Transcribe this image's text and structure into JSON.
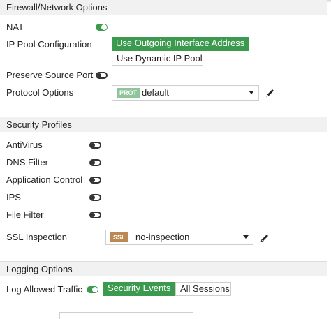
{
  "firewall": {
    "header": "Firewall/Network Options",
    "nat": {
      "label": "NAT",
      "enabled": true
    },
    "ip_pool": {
      "label": "IP Pool Configuration",
      "options": [
        "Use Outgoing Interface Address",
        "Use Dynamic IP Pool"
      ],
      "selected": "Use Outgoing Interface Address"
    },
    "preserve_source_port": {
      "label": "Preserve Source Port",
      "enabled": false
    },
    "protocol_options": {
      "label": "Protocol Options",
      "badge": "PROT",
      "value": "default",
      "badge_color": "#8fc59a"
    }
  },
  "security": {
    "header": "Security Profiles",
    "items": [
      {
        "label": "AntiVirus",
        "enabled": false
      },
      {
        "label": "DNS Filter",
        "enabled": false
      },
      {
        "label": "Application Control",
        "enabled": false
      },
      {
        "label": "IPS",
        "enabled": false
      },
      {
        "label": "File Filter",
        "enabled": false
      }
    ],
    "ssl_inspection": {
      "label": "SSL Inspection",
      "badge": "SSL",
      "value": "no-inspection",
      "badge_color": "#b98a54"
    }
  },
  "logging": {
    "header": "Logging Options",
    "log_allowed_traffic": {
      "label": "Log Allowed Traffic",
      "enabled": true,
      "options": [
        "Security Events",
        "All Sessions"
      ],
      "selected": "Security Events"
    }
  },
  "colors": {
    "accent": "#3c9a4f",
    "header_bg": "#f1f1f1"
  }
}
